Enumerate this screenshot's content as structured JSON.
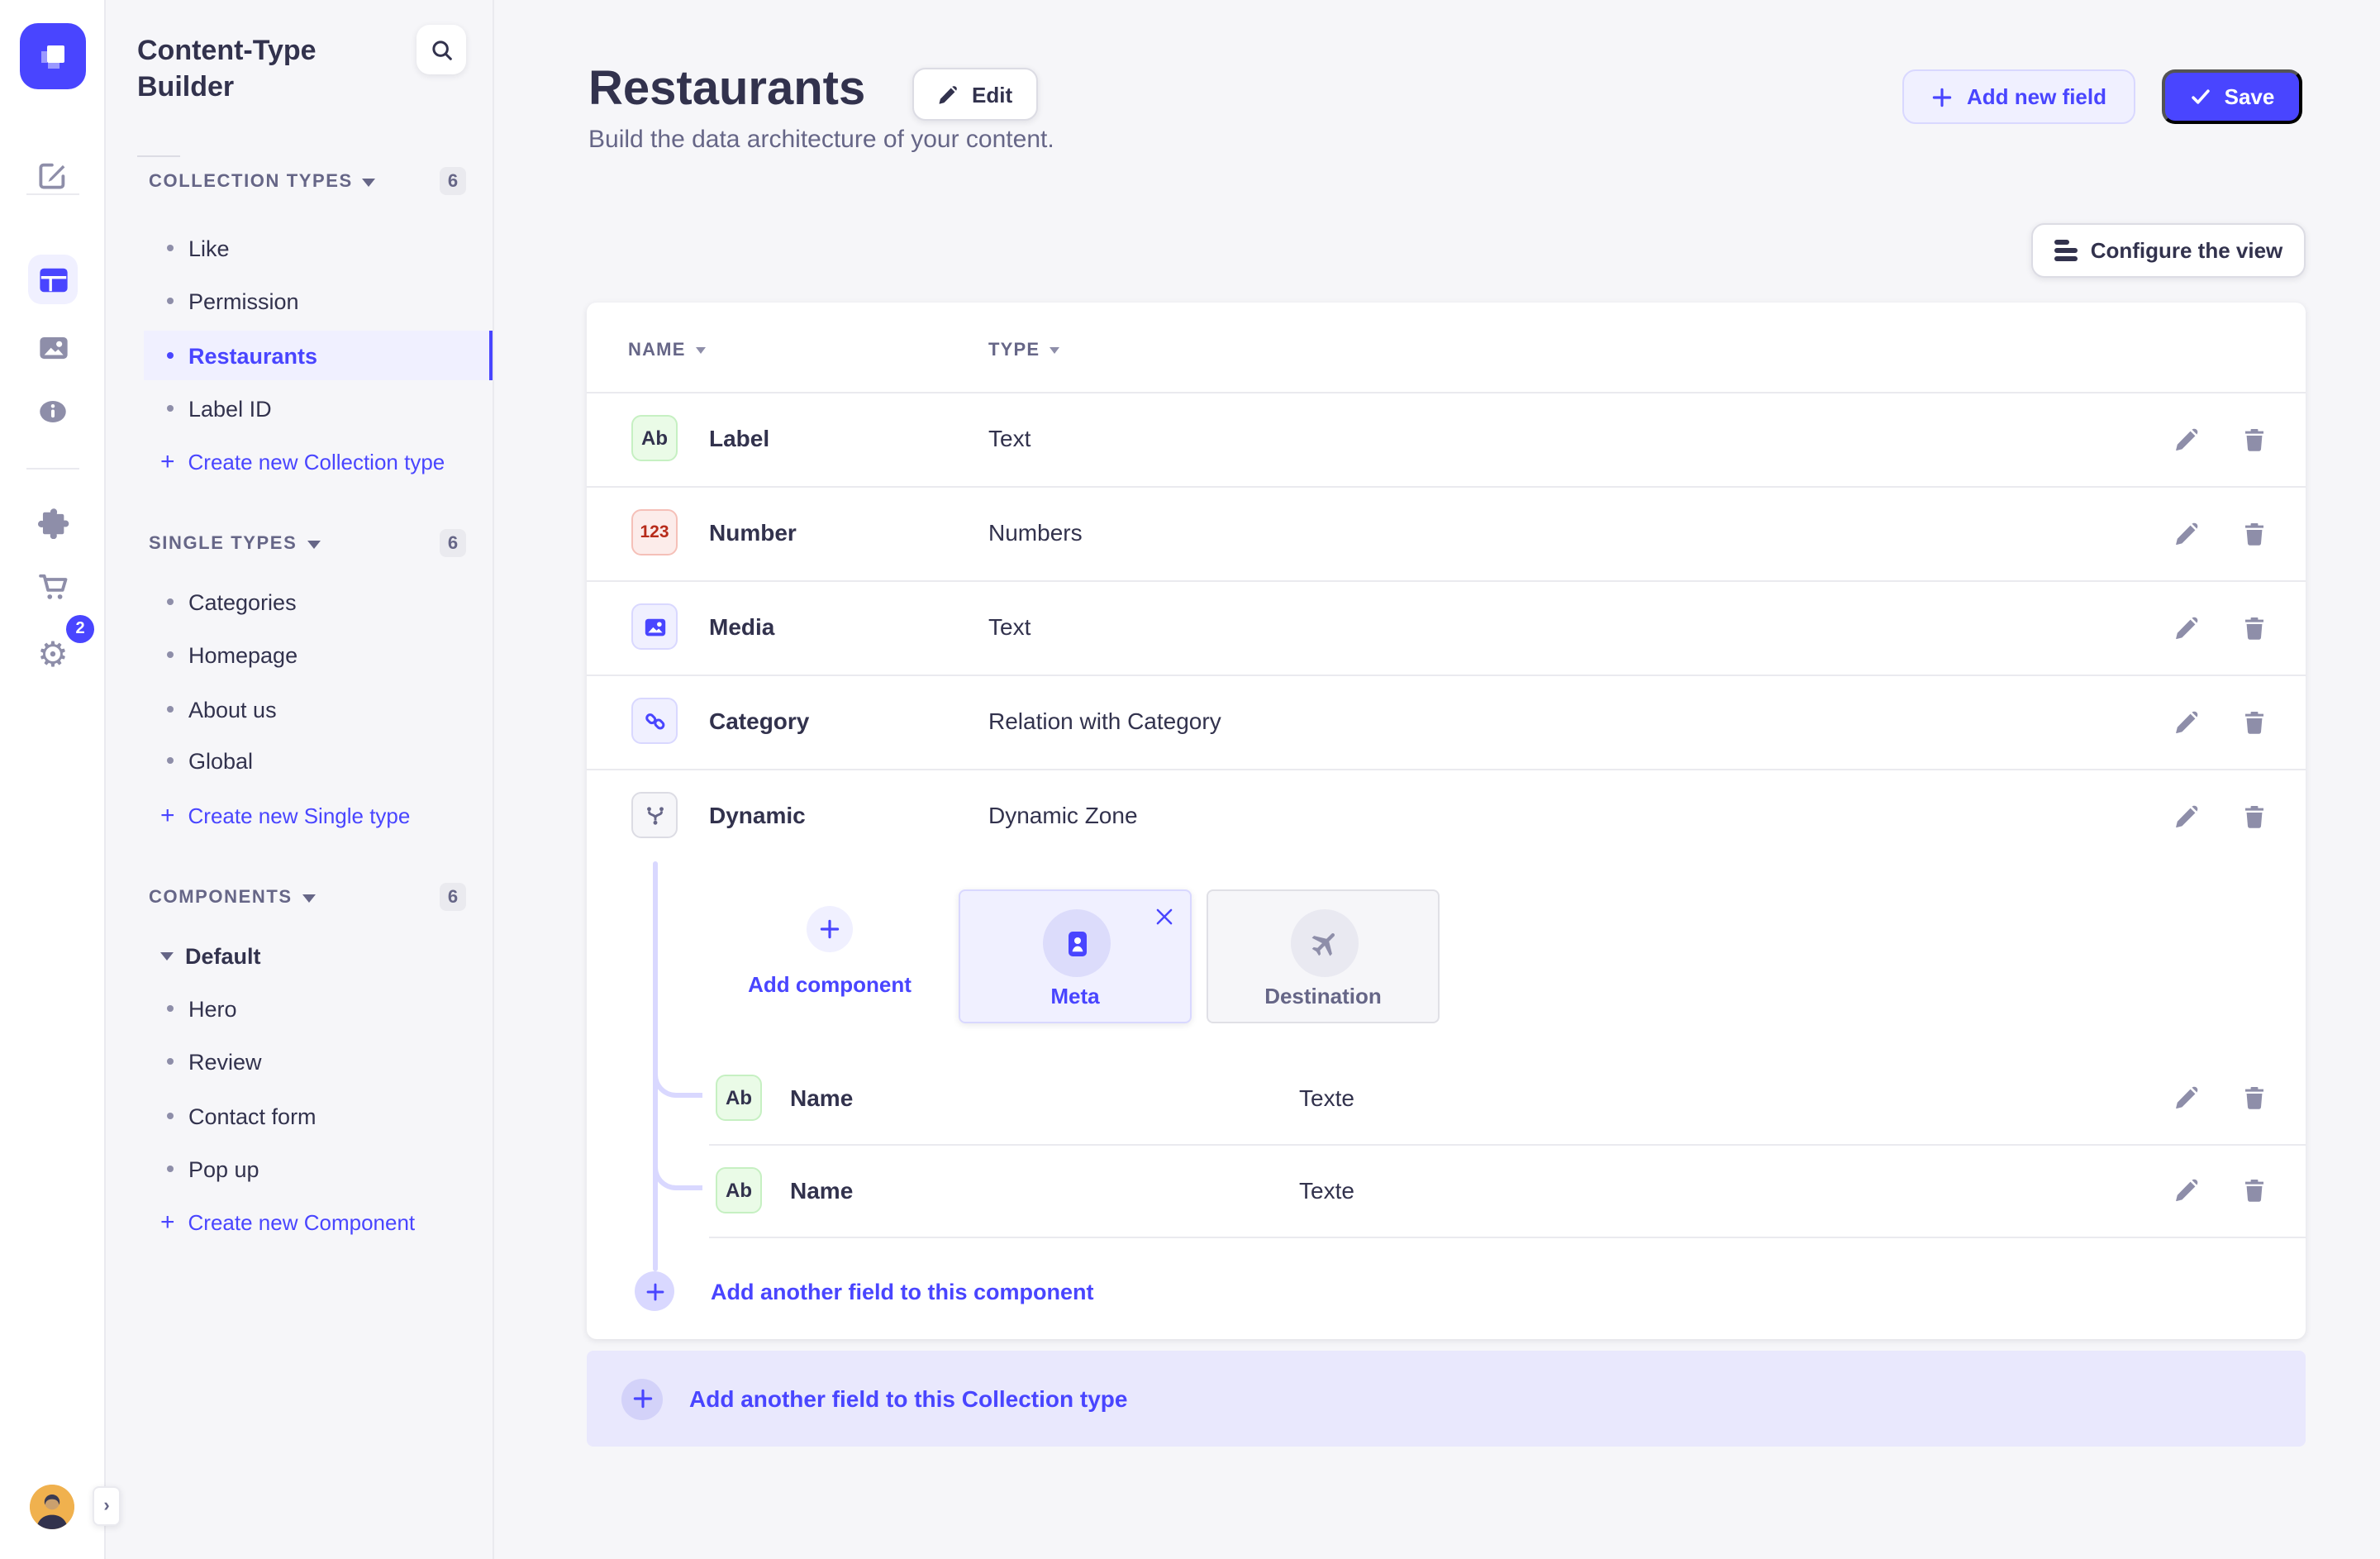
{
  "app": {
    "name": "Strapi admin"
  },
  "rail": {
    "settings_badge": "2"
  },
  "sidebar": {
    "title": "Content-Type Builder",
    "sections": [
      {
        "label": "COLLECTION TYPES",
        "count": "6",
        "items": [
          {
            "label": "Like"
          },
          {
            "label": "Permission"
          },
          {
            "label": "Restaurants"
          },
          {
            "label": "Label ID"
          }
        ],
        "action": "Create new Collection type"
      },
      {
        "label": "SINGLE TYPES",
        "count": "6",
        "items": [
          {
            "label": "Categories"
          },
          {
            "label": "Homepage"
          },
          {
            "label": "About us"
          },
          {
            "label": "Global"
          }
        ],
        "action": "Create new Single type"
      },
      {
        "label": "COMPONENTS",
        "count": "6",
        "group": "Default",
        "items": [
          {
            "label": "Hero"
          },
          {
            "label": "Review"
          },
          {
            "label": "Contact form"
          },
          {
            "label": "Pop up"
          }
        ],
        "action": "Create new Component"
      }
    ]
  },
  "header": {
    "title": "Restaurants",
    "edit": "Edit",
    "subtitle": "Build the data architecture of your content.",
    "add_field": "Add new field",
    "save": "Save"
  },
  "toolbar": {
    "configure": "Configure the view"
  },
  "table": {
    "columns": {
      "name": "NAME",
      "type": "TYPE"
    },
    "rows": [
      {
        "badge": "Ab",
        "name": "Label",
        "type": "Text"
      },
      {
        "badge": "123",
        "name": "Number",
        "type": "Numbers"
      },
      {
        "name": "Media",
        "type": "Text"
      },
      {
        "name": "Category",
        "type": "Relation with Category"
      },
      {
        "name": "Dynamic",
        "type": "Dynamic Zone"
      }
    ]
  },
  "dynamic_zone": {
    "add_component": "Add component",
    "components": [
      {
        "label": "Meta",
        "selected": true
      },
      {
        "label": "Destination",
        "selected": false
      }
    ],
    "fields": [
      {
        "badge": "Ab",
        "name": "Name",
        "type": "Texte"
      },
      {
        "badge": "Ab",
        "name": "Name",
        "type": "Texte"
      }
    ],
    "add_field": "Add another field to this component"
  },
  "banner": {
    "label": "Add another field to this Collection type"
  },
  "colors": {
    "accent": "#4945ff",
    "accent_light": "#f0f0ff",
    "accent_border": "#d9d8ff",
    "text": "#32324d",
    "muted": "#666687",
    "icon_gray": "#8e8ea9",
    "success_bg": "#eafbe7",
    "success_border": "#c6f0c2",
    "danger_bg": "#fcecea",
    "danger_border": "#f5c0b8",
    "danger_text": "#b72b1a"
  },
  "icons": {
    "search": "magnifier",
    "edit": "pencil",
    "delete": "trash",
    "save": "check",
    "add": "plus",
    "close": "x",
    "configure": "filter-lines",
    "media": "image",
    "relation": "chain-link",
    "dynamic": "branch",
    "component_meta": "id-card",
    "component_destination": "plane",
    "settings": "gear",
    "marketplace": "cart",
    "plugins": "puzzle",
    "content_manager": "pen",
    "media_library": "picture",
    "info": "info-circle"
  }
}
